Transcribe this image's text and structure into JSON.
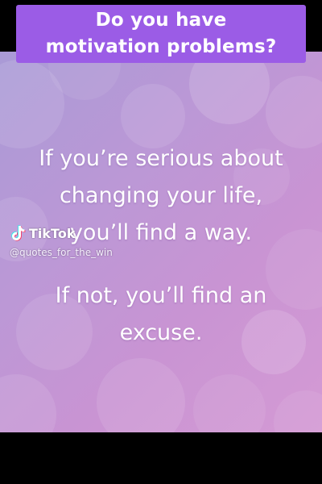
{
  "banner": {
    "line1": "Do you have",
    "line2": "motivation problems?"
  },
  "quote": {
    "part1": [
      "If you’re serious about",
      "changing your life,",
      "you’ll find a way."
    ],
    "part2": [
      "If not, you’ll find an",
      "excuse."
    ]
  },
  "watermark": {
    "brand": "TikTok",
    "handle": "@quotes_for_the_win",
    "icon": "tiktok-logo-icon"
  },
  "colors": {
    "background": "#000000",
    "banner": "#9b5ce6",
    "text": "#ffffff",
    "panel_start": "#a99ad6",
    "panel_end": "#d49ad4"
  }
}
